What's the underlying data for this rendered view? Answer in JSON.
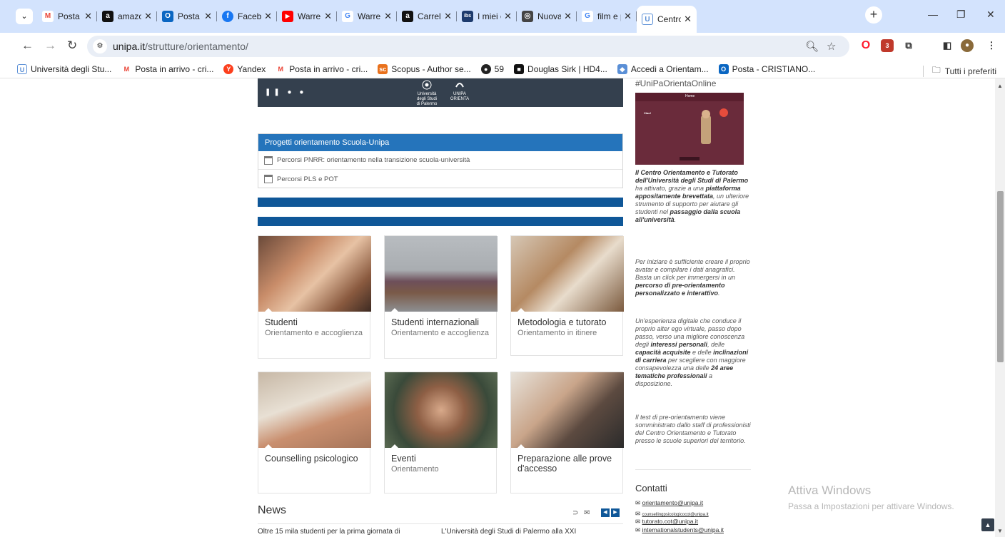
{
  "browser": {
    "tabs": [
      {
        "title": "Posta in",
        "fav": "M",
        "fav_color": "#ea4335"
      },
      {
        "title": "amazon",
        "fav": "a",
        "fav_color": "#111111"
      },
      {
        "title": "Posta -",
        "fav": "O",
        "fav_color": "#0a66c2"
      },
      {
        "title": "Faceboo",
        "fav": "f",
        "fav_color": "#1877f2"
      },
      {
        "title": "Warren",
        "fav": "▶",
        "fav_color": "#ff0000"
      },
      {
        "title": "Warren",
        "fav": "G",
        "fav_color": "#4285f4"
      },
      {
        "title": "Carrello",
        "fav": "a",
        "fav_color": "#111111"
      },
      {
        "title": "I miei or",
        "fav": "ibs",
        "fav_color": "#1d3b6d"
      },
      {
        "title": "Nuova s",
        "fav": "◎",
        "fav_color": "#444444"
      },
      {
        "title": "film e p",
        "fav": "G",
        "fav_color": "#4285f4"
      },
      {
        "title": "Centro",
        "fav": "U",
        "fav_color": "#5a8fd6"
      }
    ],
    "url_host": "unipa.it",
    "url_path": "/strutture/orientamento/",
    "bookmarks": [
      {
        "label": "Università degli Stu...",
        "fav": "U",
        "fav_color": "#5a8fd6"
      },
      {
        "label": "Posta in arrivo - cri...",
        "fav": "M",
        "fav_color": "#ea4335"
      },
      {
        "label": "Yandex",
        "fav": "Y",
        "fav_color": "#fc3f1d"
      },
      {
        "label": "Posta in arrivo - cri...",
        "fav": "M",
        "fav_color": "#ea4335"
      },
      {
        "label": "Scopus - Author se...",
        "fav": "sc",
        "fav_color": "#e9711c"
      },
      {
        "label": "59",
        "fav": "●",
        "fav_color": "#222222"
      },
      {
        "label": "Douglas Sirk | HD4...",
        "fav": "■",
        "fav_color": "#111111"
      },
      {
        "label": "Accedi a Orientam...",
        "fav": "◆",
        "fav_color": "#5a8fd6"
      },
      {
        "label": "Posta - CRISTIANO...",
        "fav": "O",
        "fav_color": "#0a66c2"
      }
    ],
    "all_bookmarks": "Tutti i preferiti",
    "ext_badge": "3"
  },
  "page": {
    "hero_logo1": "Università degli Studi di Palermo",
    "hero_logo2": "UNIPA ORIENTA",
    "projects": {
      "title": "Progetti orientamento Scuola-Unipa",
      "items": [
        "Percorsi PNRR: orientamento nella transizione scuola-università",
        "Percorsi PLS e POT"
      ]
    },
    "cards": [
      {
        "title": "Studenti",
        "subtitle": "Orientamento e accoglienza"
      },
      {
        "title": "Studenti internazionali",
        "subtitle": "Orientamento e accoglienza"
      },
      {
        "title": "Metodologia e tutorato",
        "subtitle": "Orientamento in itinere"
      },
      {
        "title": "Counselling psicologico",
        "subtitle": ""
      },
      {
        "title": "Eventi",
        "subtitle": "Orientamento"
      },
      {
        "title": "Preparazione alle prove d'accesso",
        "subtitle": ""
      }
    ],
    "news": {
      "title": "News",
      "item1": "Oltre 15 mila studenti per la prima giornata di",
      "item2": "L'Università degli Studi di Palermo alla XXI"
    }
  },
  "sidebar": {
    "hashtag": "#UniPaOrientaOnline",
    "promo_hello": "Ciao!",
    "promo_menu": "Home",
    "p1": {
      "a": "Il Centro Orientamento e Tutorato dell'Università degli Studi di Palermo",
      "b": " ha attivato, grazie a una ",
      "c": "piattaforma appositamente brevettata",
      "d": ", un ulteriore strumento di supporto per aiutare gli studenti nel ",
      "e": "passaggio dalla scuola all'università",
      "f": "."
    },
    "p2": {
      "a": "Per iniziare è sufficiente creare il proprio avatar e compilare i dati anagrafici. Basta un click per immergersi in un ",
      "b": "percorso di pre-orientamento personalizzato e interattivo",
      "c": "."
    },
    "p3": {
      "a": "Un'esperienza digitale che conduce il proprio alter ego virtuale, passo dopo passo, verso una migliore conoscenza degli ",
      "b": "interessi personali",
      "c": ", delle ",
      "d": "capacità acquisite",
      "e": " e delle ",
      "f": "inclinazioni di carriera",
      "g": " per scegliere con maggiore consapevolezza una delle ",
      "h": "24 aree tematiche professionali",
      "i": " a disposizione."
    },
    "p4": "Il test di pre-orientamento viene somministrato dallo staff di professionisti del Centro Orientamento e Tutorato presso le scuole superiori del territorio.",
    "contacts_title": "Contatti",
    "emails": [
      "orientamento@unipa.it",
      "counsellingpsicologicocot@unipa.it",
      "tutorato.cot@unipa.it",
      "internationalstudents@unipa.it"
    ]
  },
  "windows_watermark": {
    "line1": "Attiva Windows",
    "line2": "Passa a Impostazioni per attivare Windows."
  }
}
